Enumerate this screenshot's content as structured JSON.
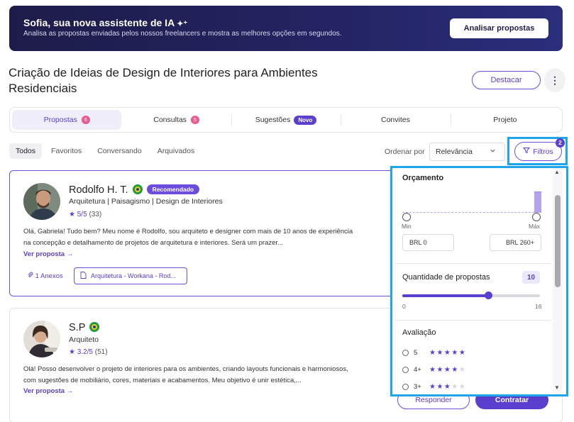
{
  "banner": {
    "title": "Sofia, sua nova assistente de IA",
    "spark": "✦⁺",
    "subtitle": "Analisa as propostas enviadas pelos nossos freelancers e mostra as melhores opções em segundos.",
    "button": "Analisar propostas"
  },
  "project": {
    "title": "Criação de Ideias de Design de Interiores para Ambientes Residenciais",
    "highlight_button": "Destacar",
    "more": "⋮"
  },
  "tabs": [
    {
      "label": "Propostas",
      "count": "6"
    },
    {
      "label": "Consultas",
      "count": "5"
    },
    {
      "label": "Sugestões",
      "badge": "Novo"
    },
    {
      "label": "Convites"
    },
    {
      "label": "Projeto"
    }
  ],
  "subtabs": [
    "Todos",
    "Favoritos",
    "Conversando",
    "Arquivados"
  ],
  "sort": {
    "label": "Ordenar por",
    "value": "Relevância"
  },
  "filters": {
    "label": "Filtros",
    "count": "2"
  },
  "proposals": [
    {
      "name": "Rodolfo H. T.",
      "badge": "Recomendado",
      "role": "Arquitetura | Paisagismo | Design de Interiores",
      "rating": "5/5",
      "reviews": "(33)",
      "description": "Olá, Gabriela! Tudo bem? Meu nome é Rodolfo, sou arquiteto e designer com mais de 10 anos de experiência na concepção e detalhamento de projetos de arquitetura e interiores. Será um prazer...",
      "see_more": "Ver proposta →",
      "attachments": "1 Anexos",
      "file": "Arquitetura - Workana - Rod..."
    },
    {
      "name": "S.P",
      "role": "Arquiteto",
      "rating": "3.2/5",
      "reviews": "(51)",
      "description": "Olá! Posso desenvolver o projeto de interiores para os ambientes, criando layouts funcionais e harmoniosos, com sugestões de mobiliário, cores, materiais e acabamentos. Meu objetivo é unir estética,...",
      "see_more": "Ver proposta →",
      "reply": "Responder",
      "hire": "Contratar"
    }
  ],
  "filter_panel": {
    "budget": {
      "title": "Orçamento",
      "min_label": "Min",
      "max_label": "Máx",
      "min_value": "BRL 0",
      "max_value": "BRL 260+"
    },
    "proposals_qty": {
      "title": "Quantidade de propostas",
      "value": "10",
      "min": "0",
      "max": "16",
      "fraction": 0.625
    },
    "rating": {
      "title": "Avaliação",
      "options": [
        {
          "label": "5",
          "stars": 5
        },
        {
          "label": "4+",
          "stars": 4
        },
        {
          "label": "3+",
          "stars": 3
        }
      ]
    }
  },
  "colors": {
    "accent": "#5b3fcf",
    "highlight_outline": "#1ea5ea",
    "banner": "#1d1c49"
  }
}
